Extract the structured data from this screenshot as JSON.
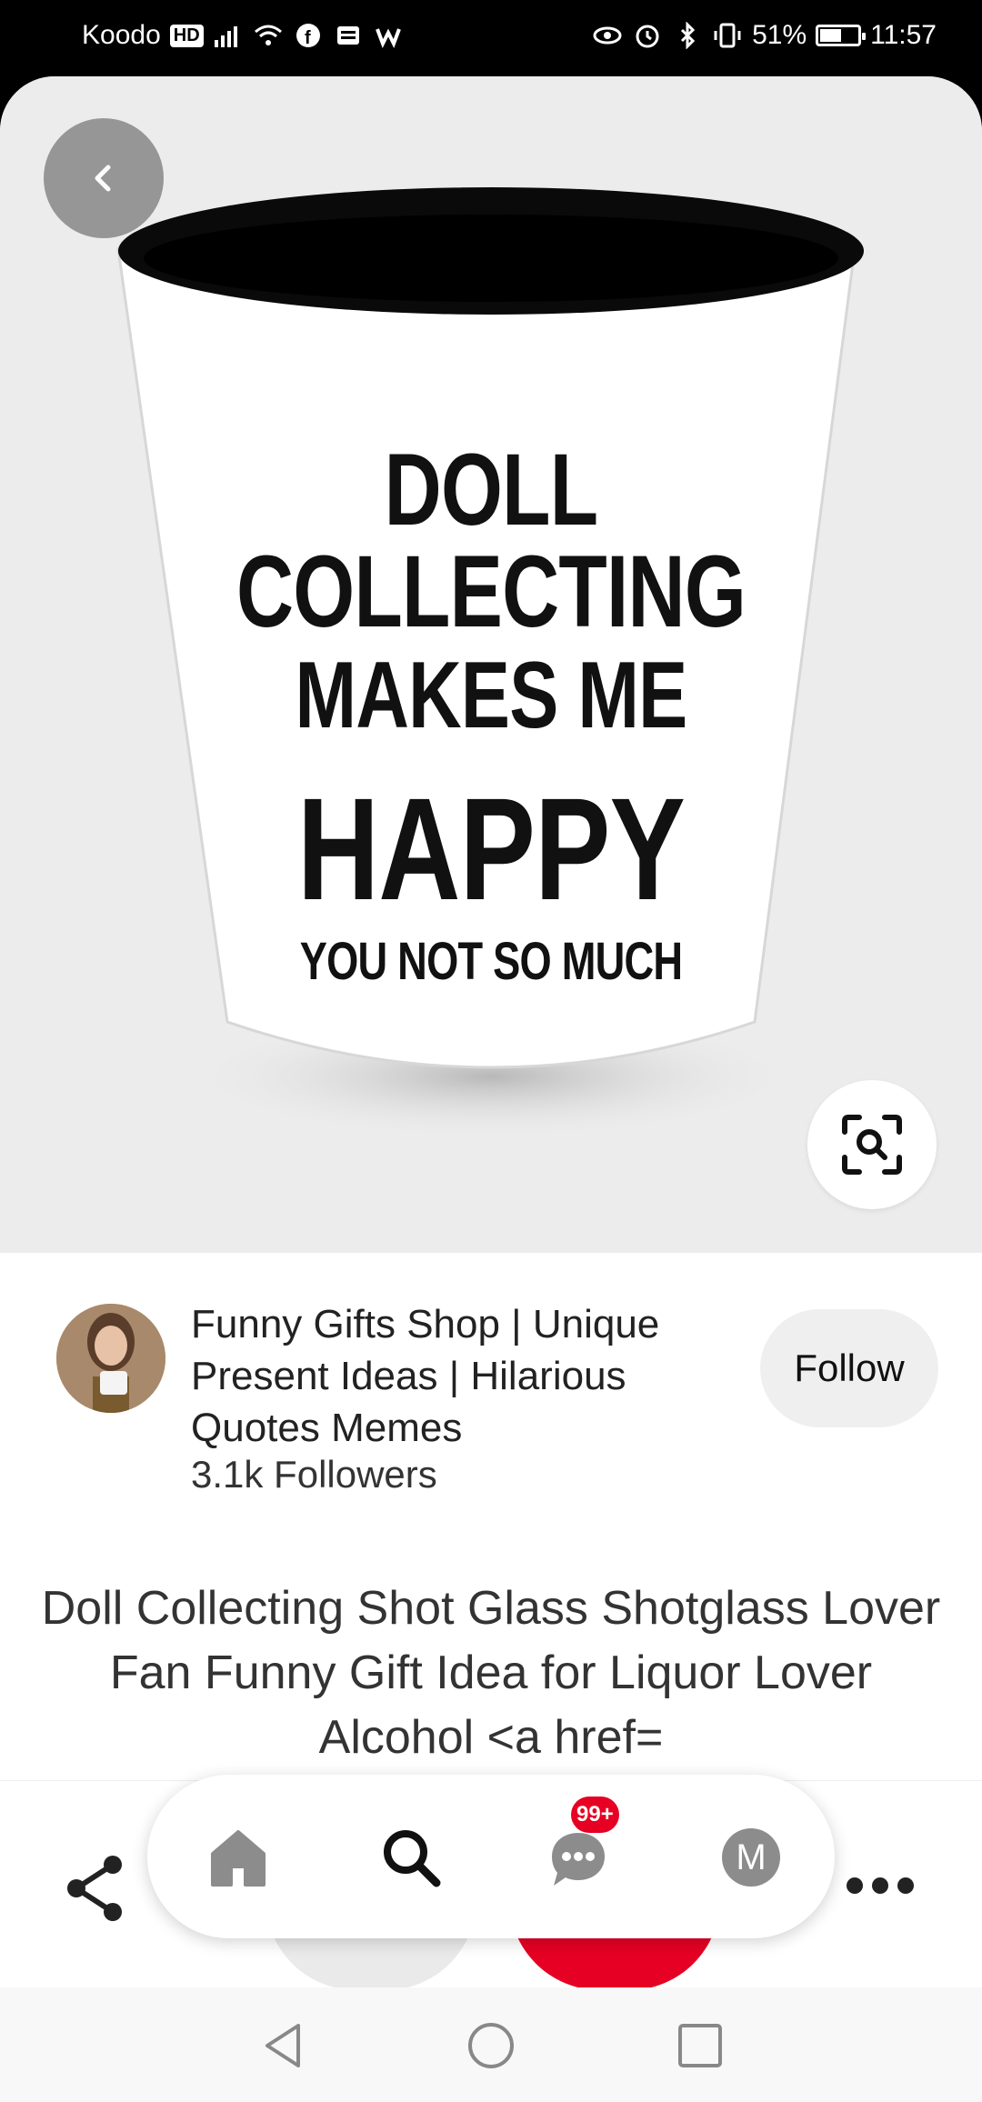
{
  "status_bar": {
    "carrier": "Koodo",
    "hd": "HD",
    "battery": "51%",
    "time": "11:57"
  },
  "pin": {
    "image_text": {
      "line1": "DOLL",
      "line2": "COLLECTING",
      "line3": "MAKES ME",
      "line4": "HAPPY",
      "line5": "YOU NOT SO MUCH"
    },
    "title": "Doll Collecting Shot Glass Shotglass Lover Fan Funny Gift Idea for Liquor Lover Alcohol <a href="
  },
  "creator": {
    "name": "Funny Gifts Shop | Unique Present Ideas | Hilarious Quotes Memes",
    "followers": "3.1k Followers",
    "follow_label": "Follow"
  },
  "bottom_nav": {
    "items": [
      "home-icon",
      "search-icon",
      "messages-icon",
      "profile-icon"
    ],
    "messages_badge": "99+",
    "profile_initial": "M"
  },
  "colors": {
    "accent": "#e60023",
    "hero_bg": "#ececec"
  }
}
